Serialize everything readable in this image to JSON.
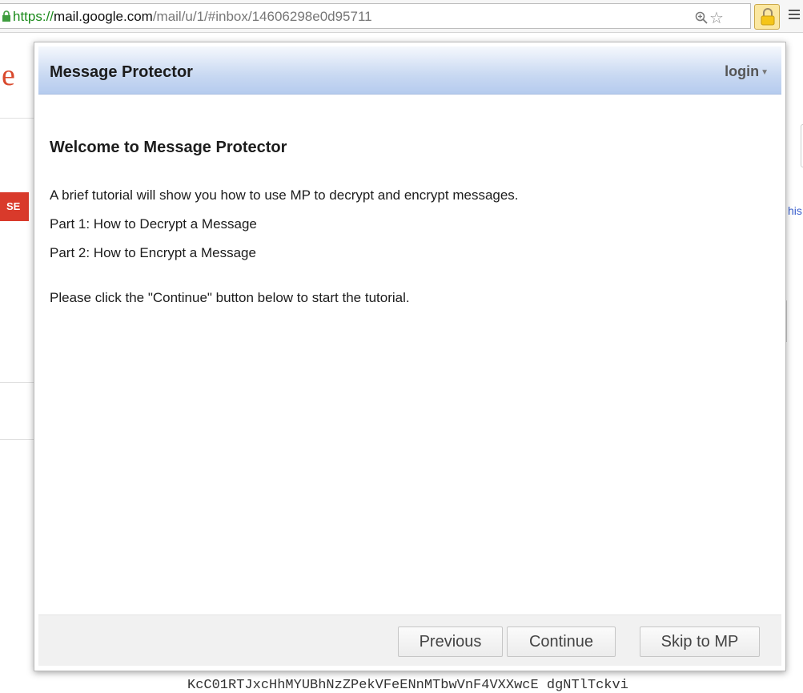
{
  "browser": {
    "url_scheme": "https://",
    "url_domain": "mail.google.com",
    "url_path": "/mail/u/1/#inbox/14606298e0d95711",
    "star_glyph": "☆",
    "extension_color": "#f5c518"
  },
  "background": {
    "logo_fragment": "e",
    "compose_fragment": "SE",
    "right_fragment": "his",
    "bottom_text": "KcC01RTJxcHhMYUBhNzZPekVFeENnMTbwVnF4VXXwcE dgNTlTckvi"
  },
  "popup": {
    "title": "Message Protector",
    "login_label": "login",
    "login_caret": "▼",
    "welcome_heading": "Welcome to Message Protector",
    "intro": "A brief tutorial will show you how to use MP to decrypt and encrypt messages.",
    "parts": [
      "Part 1: How to Decrypt a Message",
      "Part 2: How to Encrypt a Message"
    ],
    "instruction": "Please click the \"Continue\" button below to start the tutorial.",
    "buttons": {
      "previous": "Previous",
      "continue": "Continue",
      "skip": "Skip to MP"
    }
  },
  "colors": {
    "header_gradient_end": "#b5cbee",
    "compose_red": "#d93a2b"
  }
}
